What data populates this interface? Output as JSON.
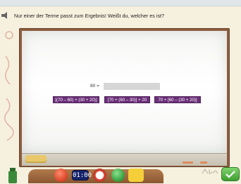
{
  "instruction": "Nur einer der Terme passt zum Ergebnis! Weißt du, welcher es ist?",
  "board": {
    "equation_prefix": "80 =",
    "terms": [
      "[(70 – 60) + (30 + 20)]",
      "[70 + (60 – 30)] + 20",
      "70 + [60 – (30 + 20)]"
    ]
  },
  "toolbar": {
    "clock_text": "01:00",
    "icons": [
      "bottle-icon",
      "red-star-icon",
      "clock-icon",
      "gauge-icon",
      "green-icon",
      "bars-icon",
      "checkmark-icon",
      "speaker-icon"
    ]
  },
  "colors": {
    "term_card": "#6a2f78",
    "board_frame": "#8b5d3e",
    "answer_slot": "#d6d6d6"
  }
}
